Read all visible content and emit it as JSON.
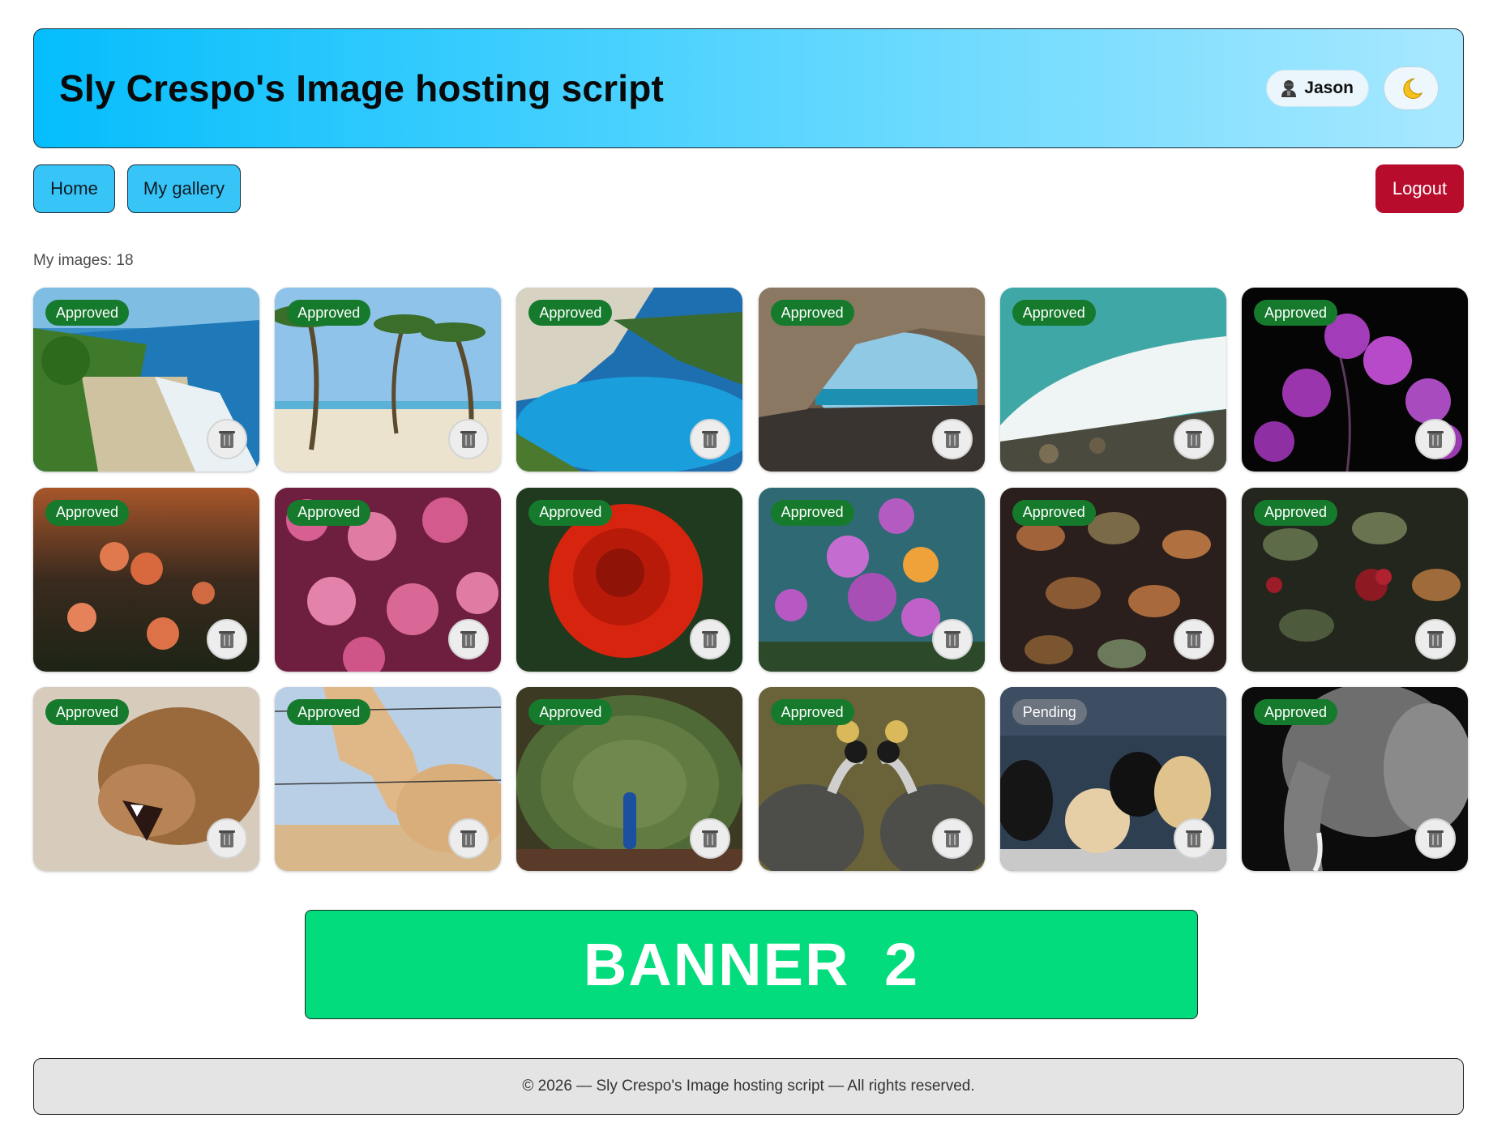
{
  "header": {
    "title": "Sly Crespo's Image hosting script",
    "user_name": "Jason",
    "user_icon": "user-icon",
    "theme_icon": "moon-icon"
  },
  "nav": {
    "home_label": "Home",
    "gallery_label": "My gallery",
    "logout_label": "Logout"
  },
  "gallery": {
    "count_label": "My images: 18",
    "delete_icon": "trash-icon",
    "images": [
      {
        "subject": "tropical beach coastline",
        "status": "Approved"
      },
      {
        "subject": "palm trees on beach",
        "status": "Approved"
      },
      {
        "subject": "cove with blue water",
        "status": "Approved"
      },
      {
        "subject": "sea cave opening",
        "status": "Approved"
      },
      {
        "subject": "ocean waves on rocks",
        "status": "Approved"
      },
      {
        "subject": "purple flowers on black",
        "status": "Approved"
      },
      {
        "subject": "orange dahlias at sunset",
        "status": "Approved"
      },
      {
        "subject": "pink flower cluster",
        "status": "Approved"
      },
      {
        "subject": "red rose",
        "status": "Approved"
      },
      {
        "subject": "purple chrysanthemums",
        "status": "Approved"
      },
      {
        "subject": "autumn leaves",
        "status": "Approved"
      },
      {
        "subject": "leaves with berries",
        "status": "Approved"
      },
      {
        "subject": "roaring lioness",
        "status": "Approved"
      },
      {
        "subject": "palomino horse by fence",
        "status": "Approved"
      },
      {
        "subject": "peacock display",
        "status": "Approved"
      },
      {
        "subject": "crowned cranes",
        "status": "Approved"
      },
      {
        "subject": "puppies on bench",
        "status": "Pending"
      },
      {
        "subject": "elephant black and white",
        "status": "Approved"
      }
    ]
  },
  "banner": {
    "text": "BANNER  2"
  },
  "footer": {
    "text": "© 2026 — Sly Crespo's Image hosting script — All rights reserved."
  },
  "colors": {
    "header_start": "#05bdfc",
    "header_end": "#a8e8ff",
    "nav_button": "#37c4f6",
    "logout": "#b80c2c",
    "approved_badge": "#167a2c",
    "pending_badge": "#6c7480",
    "banner": "#02dc7c",
    "footer_bg": "#e4e4e4"
  }
}
